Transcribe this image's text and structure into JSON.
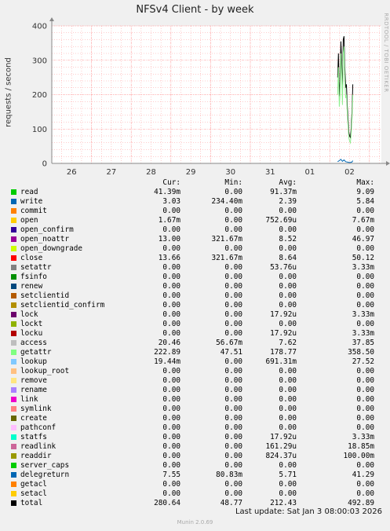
{
  "title": "NFSv4 Client - by week",
  "vendor": "RRDTOOL / TOBI OETIKER",
  "last_update": "Last update: Sat Jan  3 08:00:03 2026",
  "version": "Munin 2.0.69",
  "colors": {
    "background": "#f0f0f0",
    "canvas": "#ffffff",
    "grid": "#ff9999",
    "axis": "#888888"
  },
  "chart_data": {
    "type": "line",
    "title": "NFSv4 Client - by week",
    "ylabel": "requests / second",
    "xlabel": "",
    "ylim": [
      0,
      400
    ],
    "y_ticks": [
      0,
      100,
      200,
      300,
      400
    ],
    "x_ticks": [
      "26",
      "27",
      "28",
      "29",
      "30",
      "31",
      "01",
      "02"
    ],
    "xlim_days": [
      -0.5,
      7.8
    ],
    "grid": true,
    "series": [
      {
        "name": "total",
        "color": "#000000",
        "points": [
          [
            6.7,
            250
          ],
          [
            6.72,
            320
          ],
          [
            6.74,
            195
          ],
          [
            6.76,
            240
          ],
          [
            6.78,
            355
          ],
          [
            6.8,
            300
          ],
          [
            6.82,
            200
          ],
          [
            6.84,
            360
          ],
          [
            6.86,
            370
          ],
          [
            6.88,
            280
          ],
          [
            6.9,
            220
          ],
          [
            6.92,
            230
          ],
          [
            6.94,
            170
          ],
          [
            6.96,
            130
          ],
          [
            6.98,
            90
          ],
          [
            7.0,
            80
          ],
          [
            7.02,
            75
          ],
          [
            7.04,
            100
          ],
          [
            7.06,
            150
          ],
          [
            7.08,
            230
          ]
        ]
      },
      {
        "name": "getattr",
        "color": "#8fef8f",
        "points": [
          [
            6.7,
            200
          ],
          [
            6.72,
            280
          ],
          [
            6.74,
            165
          ],
          [
            6.76,
            200
          ],
          [
            6.78,
            320
          ],
          [
            6.8,
            260
          ],
          [
            6.82,
            170
          ],
          [
            6.84,
            320
          ],
          [
            6.86,
            340
          ],
          [
            6.88,
            240
          ],
          [
            6.9,
            190
          ],
          [
            6.92,
            200
          ],
          [
            6.94,
            150
          ],
          [
            6.96,
            110
          ],
          [
            6.98,
            75
          ],
          [
            7.0,
            65
          ],
          [
            7.02,
            60
          ],
          [
            7.04,
            85
          ],
          [
            7.06,
            130
          ],
          [
            7.08,
            200
          ]
        ]
      },
      {
        "name": "lookup",
        "color": "#0066b3",
        "points": [
          [
            6.7,
            5
          ],
          [
            6.74,
            8
          ],
          [
            6.78,
            12
          ],
          [
            6.82,
            6
          ],
          [
            6.86,
            10
          ],
          [
            6.9,
            5
          ],
          [
            6.94,
            4
          ],
          [
            6.98,
            3
          ],
          [
            7.02,
            3
          ],
          [
            7.06,
            4
          ],
          [
            7.08,
            8
          ]
        ]
      }
    ]
  },
  "legend": {
    "headers": [
      "Cur:",
      "Min:",
      "Avg:",
      "Max:"
    ],
    "rows": [
      {
        "name": "read",
        "color": "#00cc00",
        "cur": "41.39m",
        "min": "0.00",
        "avg": "91.37m",
        "max": "9.09"
      },
      {
        "name": "write",
        "color": "#0066b3",
        "cur": "3.03",
        "min": "234.40m",
        "avg": "2.39",
        "max": "5.84"
      },
      {
        "name": "commit",
        "color": "#ff8000",
        "cur": "0.00",
        "min": "0.00",
        "avg": "0.00",
        "max": "0.00"
      },
      {
        "name": "open",
        "color": "#ffcc00",
        "cur": "1.67m",
        "min": "0.00",
        "avg": "752.69u",
        "max": "7.67m"
      },
      {
        "name": "open_confirm",
        "color": "#330099",
        "cur": "0.00",
        "min": "0.00",
        "avg": "0.00",
        "max": "0.00"
      },
      {
        "name": "open_noattr",
        "color": "#990099",
        "cur": "13.00",
        "min": "321.67m",
        "avg": "8.52",
        "max": "46.97"
      },
      {
        "name": "open_downgrade",
        "color": "#ccff00",
        "cur": "0.00",
        "min": "0.00",
        "avg": "0.00",
        "max": "0.00"
      },
      {
        "name": "close",
        "color": "#ff0000",
        "cur": "13.66",
        "min": "321.67m",
        "avg": "8.64",
        "max": "50.12"
      },
      {
        "name": "setattr",
        "color": "#808080",
        "cur": "0.00",
        "min": "0.00",
        "avg": "53.76u",
        "max": "3.33m"
      },
      {
        "name": "fsinfo",
        "color": "#008f00",
        "cur": "0.00",
        "min": "0.00",
        "avg": "0.00",
        "max": "0.00"
      },
      {
        "name": "renew",
        "color": "#00487d",
        "cur": "0.00",
        "min": "0.00",
        "avg": "0.00",
        "max": "0.00"
      },
      {
        "name": "setclientid",
        "color": "#b35a00",
        "cur": "0.00",
        "min": "0.00",
        "avg": "0.00",
        "max": "0.00"
      },
      {
        "name": "setclientid_confirm",
        "color": "#b38f00",
        "cur": "0.00",
        "min": "0.00",
        "avg": "0.00",
        "max": "0.00"
      },
      {
        "name": "lock",
        "color": "#6b006b",
        "cur": "0.00",
        "min": "0.00",
        "avg": "17.92u",
        "max": "3.33m"
      },
      {
        "name": "lockt",
        "color": "#8fb300",
        "cur": "0.00",
        "min": "0.00",
        "avg": "0.00",
        "max": "0.00"
      },
      {
        "name": "locku",
        "color": "#b30000",
        "cur": "0.00",
        "min": "0.00",
        "avg": "17.92u",
        "max": "3.33m"
      },
      {
        "name": "access",
        "color": "#bebebe",
        "cur": "20.46",
        "min": "56.67m",
        "avg": "7.62",
        "max": "37.85"
      },
      {
        "name": "getattr",
        "color": "#80ff80",
        "cur": "222.89",
        "min": "47.51",
        "avg": "178.77",
        "max": "358.50"
      },
      {
        "name": "lookup",
        "color": "#80c9ff",
        "cur": "19.44m",
        "min": "0.00",
        "avg": "691.31m",
        "max": "27.52"
      },
      {
        "name": "lookup_root",
        "color": "#ffc080",
        "cur": "0.00",
        "min": "0.00",
        "avg": "0.00",
        "max": "0.00"
      },
      {
        "name": "remove",
        "color": "#ffe680",
        "cur": "0.00",
        "min": "0.00",
        "avg": "0.00",
        "max": "0.00"
      },
      {
        "name": "rename",
        "color": "#aa80ff",
        "cur": "0.00",
        "min": "0.00",
        "avg": "0.00",
        "max": "0.00"
      },
      {
        "name": "link",
        "color": "#ee00cc",
        "cur": "0.00",
        "min": "0.00",
        "avg": "0.00",
        "max": "0.00"
      },
      {
        "name": "symlink",
        "color": "#ff8080",
        "cur": "0.00",
        "min": "0.00",
        "avg": "0.00",
        "max": "0.00"
      },
      {
        "name": "create",
        "color": "#666600",
        "cur": "0.00",
        "min": "0.00",
        "avg": "0.00",
        "max": "0.00"
      },
      {
        "name": "pathconf",
        "color": "#ffbfff",
        "cur": "0.00",
        "min": "0.00",
        "avg": "0.00",
        "max": "0.00"
      },
      {
        "name": "statfs",
        "color": "#00ffcc",
        "cur": "0.00",
        "min": "0.00",
        "avg": "17.92u",
        "max": "3.33m"
      },
      {
        "name": "readlink",
        "color": "#cc6699",
        "cur": "0.00",
        "min": "0.00",
        "avg": "161.29u",
        "max": "18.85m"
      },
      {
        "name": "readdir",
        "color": "#999900",
        "cur": "0.00",
        "min": "0.00",
        "avg": "824.37u",
        "max": "100.00m"
      },
      {
        "name": "server_caps",
        "color": "#00cc00",
        "cur": "0.00",
        "min": "0.00",
        "avg": "0.00",
        "max": "0.00"
      },
      {
        "name": "delegreturn",
        "color": "#0066b3",
        "cur": "7.55",
        "min": "80.83m",
        "avg": "5.71",
        "max": "41.29"
      },
      {
        "name": "getacl",
        "color": "#ff8000",
        "cur": "0.00",
        "min": "0.00",
        "avg": "0.00",
        "max": "0.00"
      },
      {
        "name": "setacl",
        "color": "#ffcc00",
        "cur": "0.00",
        "min": "0.00",
        "avg": "0.00",
        "max": "0.00"
      },
      {
        "name": "total",
        "color": "#000000",
        "cur": "280.64",
        "min": "48.77",
        "avg": "212.43",
        "max": "492.89"
      }
    ]
  }
}
